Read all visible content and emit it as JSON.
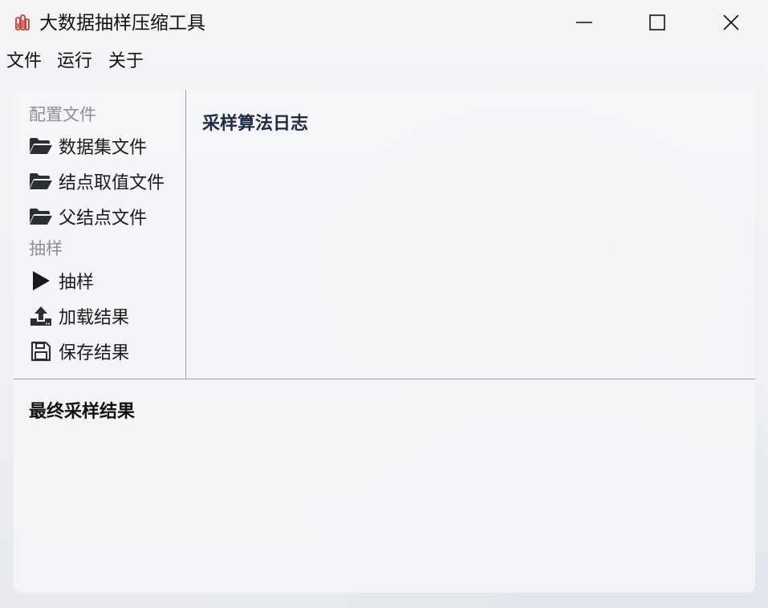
{
  "window": {
    "title": "大数据抽样压缩工具"
  },
  "menu": {
    "file": "文件",
    "run": "运行",
    "about": "关于"
  },
  "sidebar": {
    "config_section": "配置文件",
    "sample_section": "抽样",
    "items": [
      {
        "label": "数据集文件",
        "icon": "folder-open-icon"
      },
      {
        "label": "结点取值文件",
        "icon": "folder-open-icon"
      },
      {
        "label": "父结点文件",
        "icon": "folder-open-icon"
      },
      {
        "label": "抽样",
        "icon": "play-icon"
      },
      {
        "label": "加载结果",
        "icon": "upload-icon"
      },
      {
        "label": "保存结果",
        "icon": "save-icon"
      }
    ]
  },
  "log": {
    "title": "采样算法日志"
  },
  "result": {
    "title": "最终采样结果"
  },
  "colors": {
    "accent_title": "#1f2a44",
    "section_label": "#8b9096",
    "app_icon": "#d23a2a"
  }
}
